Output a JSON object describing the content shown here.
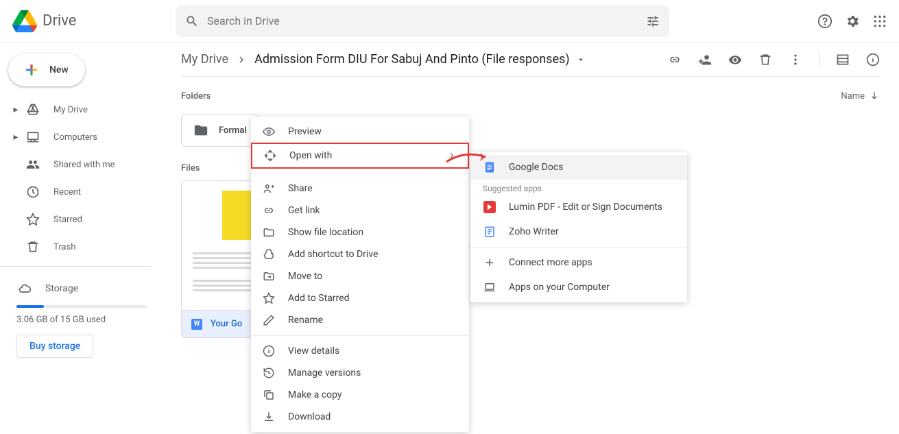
{
  "header": {
    "app_name": "Drive",
    "search_placeholder": "Search in Drive"
  },
  "sidebar": {
    "new_label": "New",
    "nav": {
      "my_drive": "My Drive",
      "computers": "Computers",
      "shared": "Shared with me",
      "recent": "Recent",
      "starred": "Starred",
      "trash": "Trash"
    },
    "storage_label": "Storage",
    "storage_text": "3.06 GB of 15 GB used",
    "buy_storage": "Buy storage"
  },
  "breadcrumb": {
    "root": "My Drive",
    "current": "Admission Form DIU For Sabuj And Pinto (File responses)"
  },
  "sections": {
    "folders": "Folders",
    "files": "Files",
    "name_sort": "Name"
  },
  "folder": {
    "name": "Formal"
  },
  "file": {
    "name": "Your Go"
  },
  "context_menu": {
    "preview": "Preview",
    "open_with": "Open with",
    "share": "Share",
    "get_link": "Get link",
    "show_location": "Show file location",
    "add_shortcut": "Add shortcut to Drive",
    "move_to": "Move to",
    "add_starred": "Add to Starred",
    "rename": "Rename",
    "view_details": "View details",
    "manage_versions": "Manage versions",
    "make_copy": "Make a copy",
    "download": "Download"
  },
  "submenu": {
    "google_docs": "Google Docs",
    "suggested": "Suggested apps",
    "lumin": "Lumin PDF - Edit or Sign Documents",
    "zoho": "Zoho Writer",
    "connect": "Connect more apps",
    "apps_computer": "Apps on your Computer"
  }
}
